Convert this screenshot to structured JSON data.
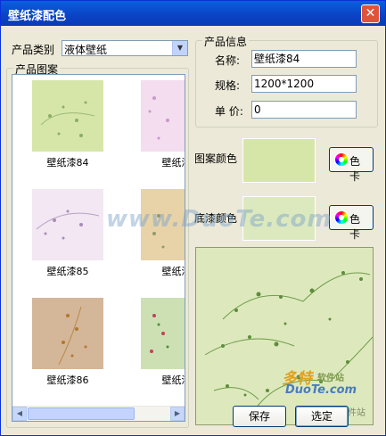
{
  "window": {
    "title": "壁纸漆配色",
    "close_glyph": "✕"
  },
  "category": {
    "label": "产品类别",
    "value": "液体壁纸",
    "arrow": "▼"
  },
  "patterns_group": {
    "title": "产品图案"
  },
  "patterns": [
    {
      "name": "壁纸漆84"
    },
    {
      "name": "壁纸漆"
    },
    {
      "name": "壁纸漆85"
    },
    {
      "name": "壁纸漆"
    },
    {
      "name": "壁纸漆86"
    },
    {
      "name": "壁纸漆"
    }
  ],
  "scroll": {
    "left": "◀",
    "right": "▶"
  },
  "info_group": {
    "title": "产品信息",
    "name_label": "名称:",
    "name_value": "壁纸漆84",
    "spec_label": "规格:",
    "spec_value": "1200*1200",
    "price_label": "单 价:",
    "price_value": "0"
  },
  "pattern_color": {
    "label": "图案颜色",
    "button": "色 卡",
    "color": "#D6E6A9"
  },
  "base_color": {
    "label": "底漆颜色",
    "button": "色 卡",
    "color": "#DCE9BE"
  },
  "buttons": {
    "save": "保存",
    "select": "选定"
  },
  "watermark": {
    "text": "www.DuoTe.com",
    "logo": "多特",
    "logo_sub": "软件站",
    "logo_site": "DuoTe.com",
    "site_label": "软件站"
  },
  "colors": {
    "thumb_green": "#D6E6A9",
    "thumb_pink": "#F3DDEE",
    "thumb_lilac": "#F2E7F2",
    "thumb_tan": "#E8D3A9",
    "thumb_brown": "#D4B699",
    "thumb_mint": "#CDE0B4"
  }
}
